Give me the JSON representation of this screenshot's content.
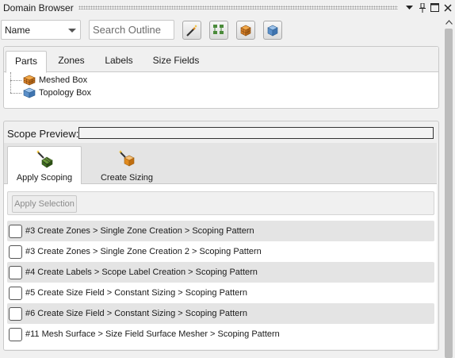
{
  "window": {
    "title": "Domain Browser"
  },
  "toolbar": {
    "select_value": "Name",
    "search_placeholder": "Search Outline",
    "buttons": [
      "wand-icon",
      "tree-icon",
      "meshed-box-icon",
      "topology-box-icon"
    ]
  },
  "outline_tabs": [
    "Parts",
    "Zones",
    "Labels",
    "Size Fields"
  ],
  "outline_active_tab": "Parts",
  "tree": [
    {
      "label": "Meshed Box",
      "icon": "meshed-box-icon"
    },
    {
      "label": "Topology Box",
      "icon": "topology-box-icon"
    }
  ],
  "scope": {
    "label": "Scope Preview:"
  },
  "action_tabs": [
    {
      "label": "Apply Scoping",
      "icon": "apply-scoping-icon"
    },
    {
      "label": "Create Sizing",
      "icon": "create-sizing-icon"
    }
  ],
  "apply_selection_label": "Apply Selection",
  "patterns": [
    "#3 Create Zones > Single Zone Creation > Scoping Pattern",
    "#3 Create Zones > Single Zone Creation 2 > Scoping Pattern",
    "#4 Create Labels > Scope Label Creation > Scoping Pattern",
    "#5 Create Size Field > Constant Sizing > Scoping Pattern",
    "#6 Create Size Field > Constant Sizing > Scoping Pattern",
    "#11 Mesh Surface > Size Field Surface Mesher > Scoping Pattern"
  ],
  "colors": {
    "accent_orange": "#e08a1e",
    "topology_blue": "#5b8fc9",
    "mesh_green": "#2e7d32"
  }
}
